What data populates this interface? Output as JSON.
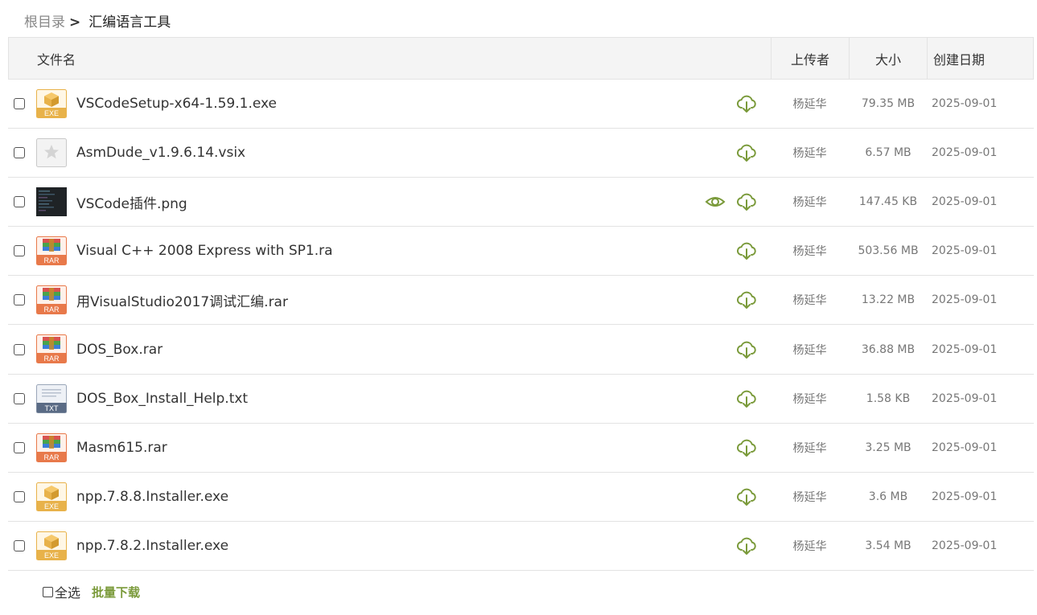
{
  "breadcrumb": {
    "root": "根目录",
    "separator": ">",
    "current": "汇编语言工具"
  },
  "table": {
    "headers": {
      "name": "文件名",
      "uploader": "上传者",
      "size": "大小",
      "date": "创建日期"
    },
    "rows": [
      {
        "icon": "exe",
        "name": "VSCodeSetup-x64-1.59.1.exe",
        "preview": false,
        "uploader": "杨延华",
        "size": "79.35 MB",
        "date": "2025-09-01"
      },
      {
        "icon": "generic",
        "name": "AsmDude_v1.9.6.14.vsix",
        "preview": false,
        "uploader": "杨延华",
        "size": "6.57 MB",
        "date": "2025-09-01"
      },
      {
        "icon": "image",
        "name": "VSCode插件.png",
        "preview": true,
        "uploader": "杨延华",
        "size": "147.45 KB",
        "date": "2025-09-01"
      },
      {
        "icon": "rar",
        "name": "Visual C++ 2008 Express with SP1.ra",
        "preview": false,
        "uploader": "杨延华",
        "size": "503.56 MB",
        "date": "2025-09-01"
      },
      {
        "icon": "rar",
        "name": "用VisualStudio2017调试汇编.rar",
        "preview": false,
        "uploader": "杨延华",
        "size": "13.22 MB",
        "date": "2025-09-01"
      },
      {
        "icon": "rar",
        "name": "DOS_Box.rar",
        "preview": false,
        "uploader": "杨延华",
        "size": "36.88 MB",
        "date": "2025-09-01"
      },
      {
        "icon": "txt",
        "name": "DOS_Box_Install_Help.txt",
        "preview": false,
        "uploader": "杨延华",
        "size": "1.58 KB",
        "date": "2025-09-01"
      },
      {
        "icon": "rar",
        "name": "Masm615.rar",
        "preview": false,
        "uploader": "杨延华",
        "size": "3.25 MB",
        "date": "2025-09-01"
      },
      {
        "icon": "exe",
        "name": "npp.7.8.8.Installer.exe",
        "preview": false,
        "uploader": "杨延华",
        "size": "3.6 MB",
        "date": "2025-09-01"
      },
      {
        "icon": "exe",
        "name": "npp.7.8.2.Installer.exe",
        "preview": false,
        "uploader": "杨延华",
        "size": "3.54 MB",
        "date": "2025-09-01"
      }
    ]
  },
  "icon_labels": {
    "exe": "EXE",
    "rar": "RAR",
    "txt": "TXT"
  },
  "footer": {
    "select_all": "全选",
    "batch_download": "批量下载"
  },
  "colors": {
    "accent_green": "#7a9a3a",
    "exe_gold": "#e8b24a",
    "rar_orange": "#e8794a",
    "txt_slate": "#5a6b85"
  }
}
